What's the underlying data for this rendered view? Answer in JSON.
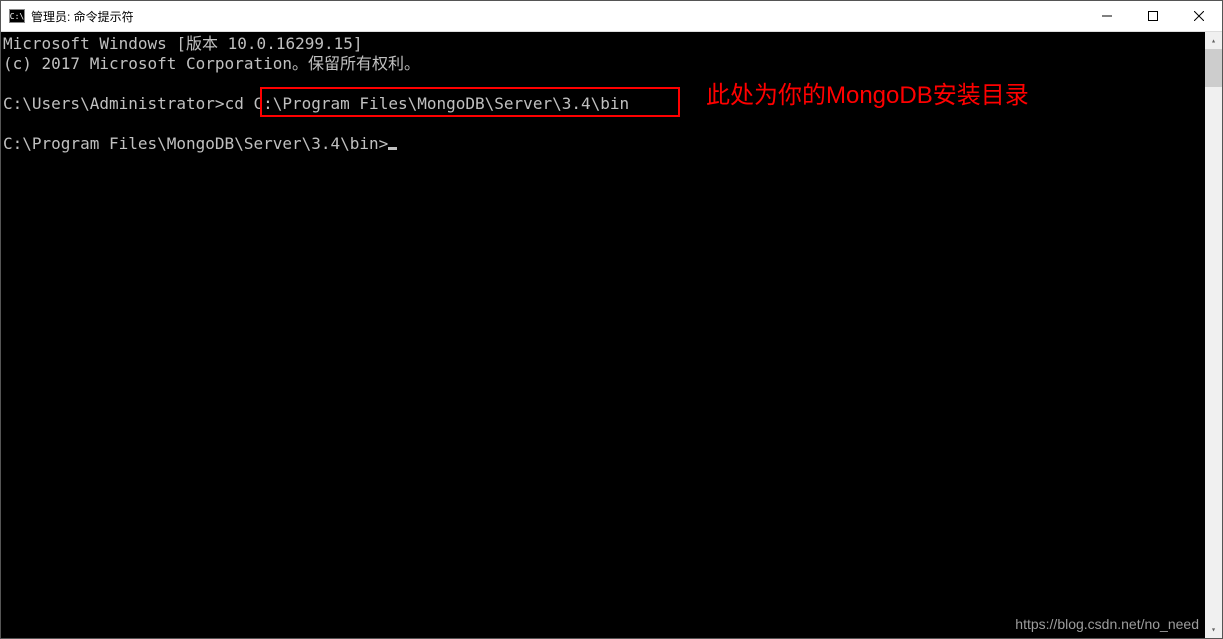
{
  "titlebar": {
    "icon_text": "C:\\",
    "title": "管理员: 命令提示符"
  },
  "terminal": {
    "line1": "Microsoft Windows [版本 10.0.16299.15]",
    "line2": "(c) 2017 Microsoft Corporation。保留所有权利。",
    "line3_prompt": "C:\\Users\\Administrator>",
    "line3_cmd": "cd C:\\Program Files\\MongoDB\\Server\\3.4\\bin",
    "line4_prompt": "C:\\Program Files\\MongoDB\\Server\\3.4\\bin>"
  },
  "annotation": {
    "text": "此处为你的MongoDB安装目录"
  },
  "watermark": "https://blog.csdn.net/no_need"
}
